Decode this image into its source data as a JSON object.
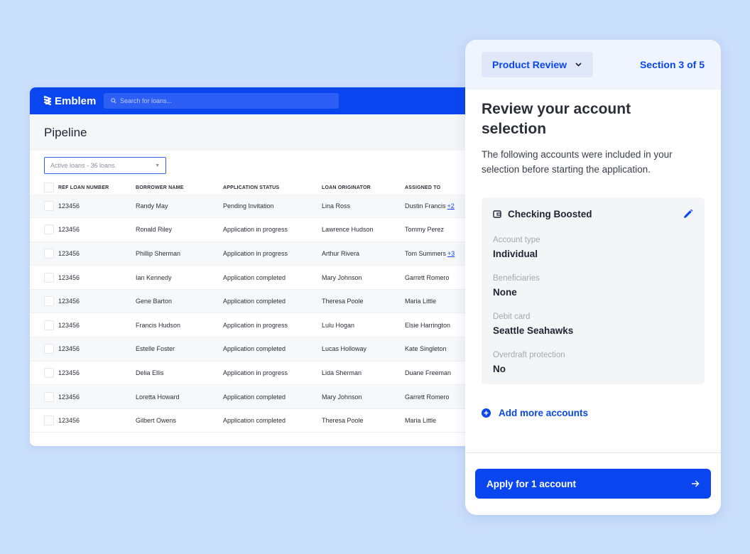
{
  "app": {
    "name": "Emblem"
  },
  "search": {
    "placeholder": "Search for loans..."
  },
  "pipeline": {
    "title": "Pipeline",
    "filter": {
      "selected": "Active loans - 36 loans."
    },
    "columns": [
      "REF LOAN NUMBER",
      "BORROWER NAME",
      "APPLICATION STATUS",
      "LOAN ORIGINATOR",
      "ASSIGNED TO"
    ],
    "rows": [
      {
        "ref": "123456",
        "borrower": "Randy May",
        "status": "Pending Invitation",
        "originator": "Lina Ross",
        "assigned": "Dustin Francis",
        "extra": "+2"
      },
      {
        "ref": "123456",
        "borrower": "Ronald Riley",
        "status": "Application in progress",
        "originator": "Lawrence Hudson",
        "assigned": "Tommy Perez",
        "extra": ""
      },
      {
        "ref": "123456",
        "borrower": "Phillip Sherman",
        "status": "Application in progress",
        "originator": "Arthur Rivera",
        "assigned": "Tom Summers",
        "extra": "+3"
      },
      {
        "ref": "123456",
        "borrower": "Ian Kennedy",
        "status": "Application completed",
        "originator": "Mary Johnson",
        "assigned": "Garrett Romero",
        "extra": ""
      },
      {
        "ref": "123456",
        "borrower": "Gene Barton",
        "status": "Application completed",
        "originator": "Theresa Poole",
        "assigned": "Maria Little",
        "extra": ""
      },
      {
        "ref": "123456",
        "borrower": "Francis Hudson",
        "status": "Application in progress",
        "originator": "Lulu Hogan",
        "assigned": "Elsie Harrington",
        "extra": ""
      },
      {
        "ref": "123456",
        "borrower": "Estelle Foster",
        "status": "Application completed",
        "originator": "Lucas Holloway",
        "assigned": "Kate Singleton",
        "extra": ""
      },
      {
        "ref": "123456",
        "borrower": "Delia Ellis",
        "status": "Application in progress",
        "originator": "Lida Sherman",
        "assigned": "Duane Freeman",
        "extra": ""
      },
      {
        "ref": "123456",
        "borrower": "Loretta Howard",
        "status": "Application completed",
        "originator": "Mary Johnson",
        "assigned": "Garrett Romero",
        "extra": ""
      },
      {
        "ref": "123456",
        "borrower": "Gilbert Owens",
        "status": "Application completed",
        "originator": "Theresa Poole",
        "assigned": "Maria Little",
        "extra": ""
      }
    ]
  },
  "review": {
    "step_selector": "Product Review",
    "section": "Section 3 of 5",
    "heading": "Review your account selection",
    "description": "The following accounts were included in your selection before starting the application.",
    "account": {
      "name": "Checking Boosted",
      "fields": [
        {
          "label": "Account type",
          "value": "Individual"
        },
        {
          "label": "Beneficiaries",
          "value": "None"
        },
        {
          "label": "Debit card",
          "value": "Seattle Seahawks"
        },
        {
          "label": "Overdraft protection",
          "value": "No"
        }
      ]
    },
    "add_more": "Add more accounts",
    "apply": "Apply for 1 account"
  },
  "colors": {
    "brand": "#0a46f0",
    "background": "#cadffc"
  },
  "icons": [
    "emblem-logo-icon",
    "search-icon",
    "chevron-down-icon",
    "wallet-icon",
    "pencil-icon",
    "plus-circle-icon",
    "arrow-right-icon"
  ]
}
